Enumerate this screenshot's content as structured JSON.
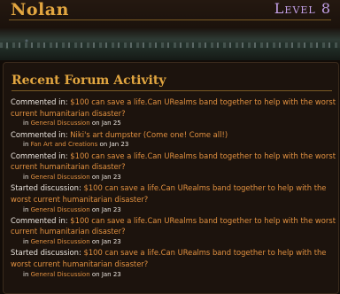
{
  "profile": {
    "username": "Nolan",
    "level": "Level 8"
  },
  "forum": {
    "title": "Recent Forum Activity",
    "activities": [
      {
        "action": "Commented in: ",
        "topic": "$100 can save a life.Can URealms band together to help with the worst current humanitarian disaster?",
        "in_label": "in ",
        "category": "General Discussion",
        "date_label": " on Jan 25"
      },
      {
        "action": "Commented in: ",
        "topic": "Niki's art dumpster (Come one! Come all!)",
        "in_label": "in ",
        "category": "Fan Art and Creations",
        "date_label": " on Jan 23"
      },
      {
        "action": "Commented in: ",
        "topic": "$100 can save a life.Can URealms band together to help with the worst current humanitarian disaster?",
        "in_label": "in ",
        "category": "General Discussion",
        "date_label": " on Jan 23"
      },
      {
        "action": "Started discussion: ",
        "topic": "$100 can save a life.Can URealms band together to help with the worst current humanitarian disaster?",
        "in_label": "in ",
        "category": "General Discussion",
        "date_label": " on Jan 23"
      },
      {
        "action": "Commented in: ",
        "topic": "$100 can save a life.Can URealms band together to help with the worst current humanitarian disaster?",
        "in_label": "in ",
        "category": "General Discussion",
        "date_label": " on Jan 23"
      },
      {
        "action": "Started discussion: ",
        "topic": "$100 can save a life.Can URealms band together to help with the worst current humanitarian disaster?",
        "in_label": "in ",
        "category": "General Discussion",
        "date_label": " on Jan 23"
      }
    ]
  }
}
